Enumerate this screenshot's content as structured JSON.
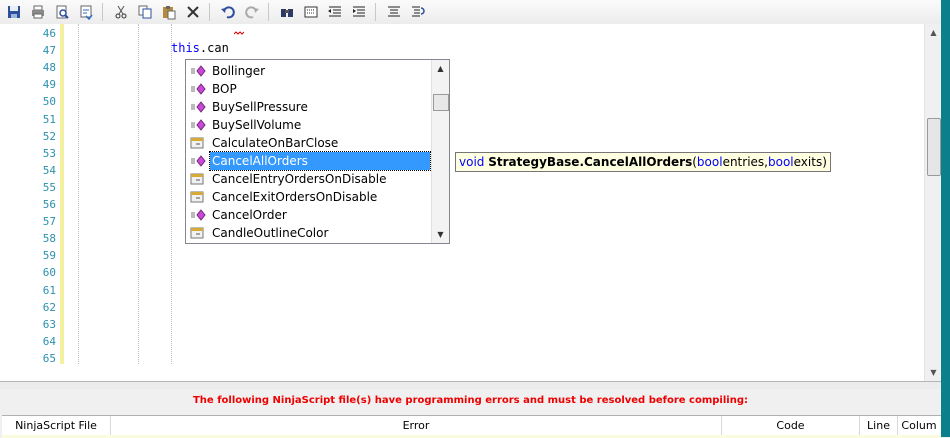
{
  "toolbar": {
    "buttons": [
      {
        "name": "save-icon"
      },
      {
        "name": "print-icon"
      },
      {
        "name": "print-preview-icon"
      },
      {
        "name": "format-icon"
      },
      {
        "name": "cut-icon"
      },
      {
        "name": "copy-icon"
      },
      {
        "name": "paste-icon"
      },
      {
        "name": "delete-icon"
      },
      {
        "name": "undo-icon"
      },
      {
        "name": "redo-icon"
      },
      {
        "name": "find-icon"
      },
      {
        "name": "replace-icon"
      },
      {
        "name": "outdent-icon"
      },
      {
        "name": "indent-icon"
      },
      {
        "name": "comment-icon"
      },
      {
        "name": "uncomment-icon"
      }
    ]
  },
  "editor": {
    "line_numbers": [
      "46",
      "47",
      "48",
      "49",
      "50",
      "51",
      "52",
      "53",
      "54",
      "55",
      "56",
      "57",
      "58",
      "59",
      "60",
      "61",
      "62",
      "63",
      "64",
      "65"
    ],
    "code": {
      "keyword": "this",
      "rest": ".can"
    },
    "colors": {
      "line_number": "#2b91af",
      "keyword": "#0000ff",
      "gutter_mark": "#f3f0a0"
    }
  },
  "autocomplete": {
    "items": [
      {
        "label": "Bollinger",
        "kind": "method"
      },
      {
        "label": "BOP",
        "kind": "method"
      },
      {
        "label": "BuySellPressure",
        "kind": "method"
      },
      {
        "label": "BuySellVolume",
        "kind": "method"
      },
      {
        "label": "CalculateOnBarClose",
        "kind": "property"
      },
      {
        "label": "CancelAllOrders",
        "kind": "method",
        "selected": true
      },
      {
        "label": "CancelEntryOrdersOnDisable",
        "kind": "property"
      },
      {
        "label": "CancelExitOrdersOnDisable",
        "kind": "property"
      },
      {
        "label": "CancelOrder",
        "kind": "method"
      },
      {
        "label": "CandleOutlineColor",
        "kind": "property"
      }
    ],
    "selection_color": "#3399ff"
  },
  "tooltip": {
    "return_type": "void",
    "signature": "StrategyBase.CancelAllOrders",
    "open_paren": "(",
    "p1_type": "bool",
    "p1_name": " entries, ",
    "p2_type": "bool",
    "p2_name": " exits",
    "close_paren": ")"
  },
  "errors": {
    "message": "The following NinjaScript file(s) have programming errors and must be resolved before compiling:",
    "message_color": "#ee0000",
    "columns": [
      "NinjaScript File",
      "Error",
      "Code",
      "Line",
      "Colum"
    ]
  }
}
